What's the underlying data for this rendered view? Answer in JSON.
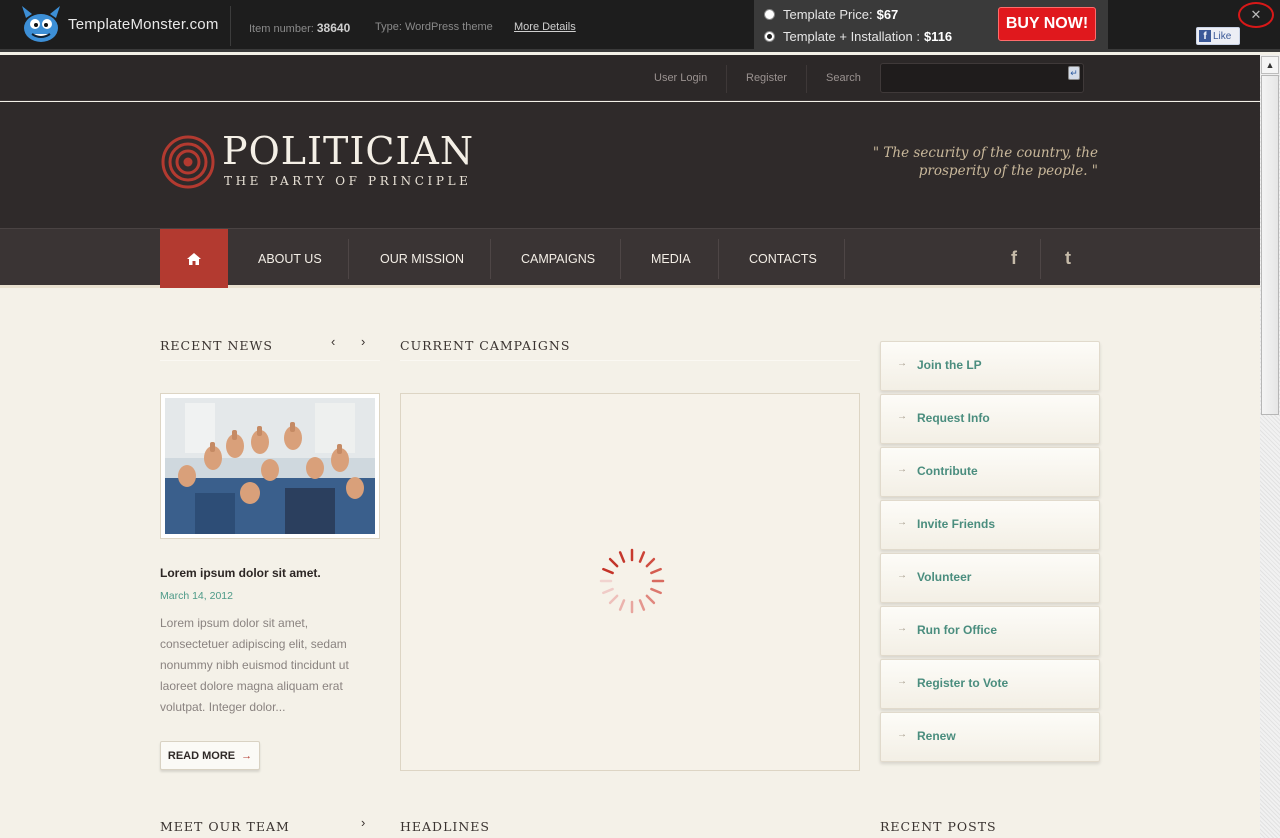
{
  "tm_bar": {
    "logo_text": "TemplateMonster.com",
    "item_number_label": "Item number:",
    "item_number": "38640",
    "type_label": "Type:",
    "type_value": "WordPress theme",
    "more_details": "More Details",
    "price_label": "Template Price:",
    "price_value": "$67",
    "install_label": "Template + Installation :",
    "install_value": "$116",
    "buy_now": "BUY NOW!",
    "close_glyph": "✕",
    "fb_like": "Like"
  },
  "utility": {
    "user_login": "User Login",
    "register": "Register",
    "search_label": "Search",
    "search_value": ""
  },
  "header": {
    "title": "POLITICIAN",
    "subtitle": "THE PARTY OF PRINCIPLE",
    "quote": "\" The security of the country, the prosperity of the people. \""
  },
  "nav": {
    "items": [
      "ABOUT US",
      "OUR MISSION",
      "CAMPAIGNS",
      "MEDIA",
      "CONTACTS"
    ],
    "social": [
      "facebook-icon",
      "twitter-icon"
    ]
  },
  "recent_news": {
    "title": "RECENT NEWS",
    "post_title": "Lorem ipsum dolor sit amet.",
    "post_date": "March 14, 2012",
    "post_excerpt": "Lorem ipsum dolor sit amet, consectetuer adipiscing elit, sedam nonummy nibh euismod tincidunt ut laoreet dolore magna aliquam erat volutpat. Integer dolor...",
    "read_more": "READ MORE",
    "read_more_arrow": "→"
  },
  "campaigns": {
    "title": "CURRENT CAMPAIGNS"
  },
  "sidebar": {
    "arrow": "→",
    "items": [
      "Join the LP",
      "Request Info",
      "Contribute",
      "Invite Friends",
      "Volunteer",
      "Run for Office",
      "Register to Vote",
      "Renew"
    ]
  },
  "bottom": {
    "team": "MEET OUR TEAM",
    "headlines": "HEADLINES",
    "recent_posts": "RECENT POSTS"
  },
  "colors": {
    "accent_red": "#b33a30",
    "link_teal": "#4a8d7e",
    "buy_red": "#e0181d"
  }
}
